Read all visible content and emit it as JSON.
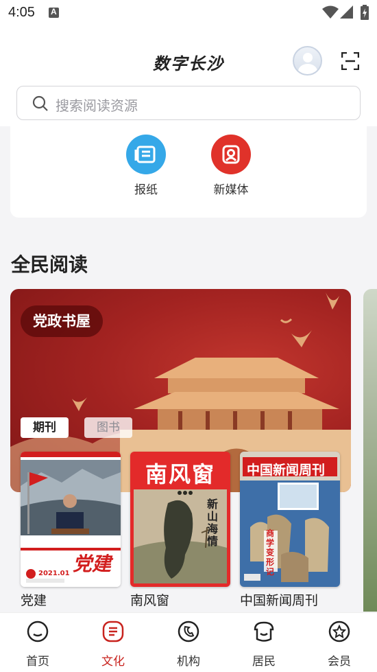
{
  "status": {
    "time": "4:05"
  },
  "header": {
    "title": "数字长沙"
  },
  "search": {
    "placeholder": "搜索阅读资源"
  },
  "services": [
    {
      "label": "报纸",
      "icon": "newspaper-icon",
      "color": "#35a8e8"
    },
    {
      "label": "新媒体",
      "icon": "new-media-icon",
      "color": "#e0322a"
    }
  ],
  "reading": {
    "title": "全民阅读",
    "banner_chip": "党政书屋",
    "tabs": [
      "期刊",
      "图书"
    ],
    "books": [
      {
        "title": "党建",
        "cover_masthead": "党建",
        "cover_issue": "2021.01"
      },
      {
        "title": "南风窗",
        "cover_masthead": "南风窗",
        "cover_headline": "新山海情"
      },
      {
        "title": "中国新闻周刊",
        "cover_masthead": "中国新闻周刊",
        "cover_headline": "商学变形记"
      }
    ]
  },
  "nav": [
    {
      "label": "首页",
      "icon": "home-icon"
    },
    {
      "label": "文化",
      "icon": "culture-icon",
      "active": true
    },
    {
      "label": "机构",
      "icon": "institution-icon"
    },
    {
      "label": "居民",
      "icon": "resident-icon"
    },
    {
      "label": "会员",
      "icon": "member-icon"
    }
  ],
  "colors": {
    "accent": "#c8231e",
    "banner": "#a32321"
  }
}
